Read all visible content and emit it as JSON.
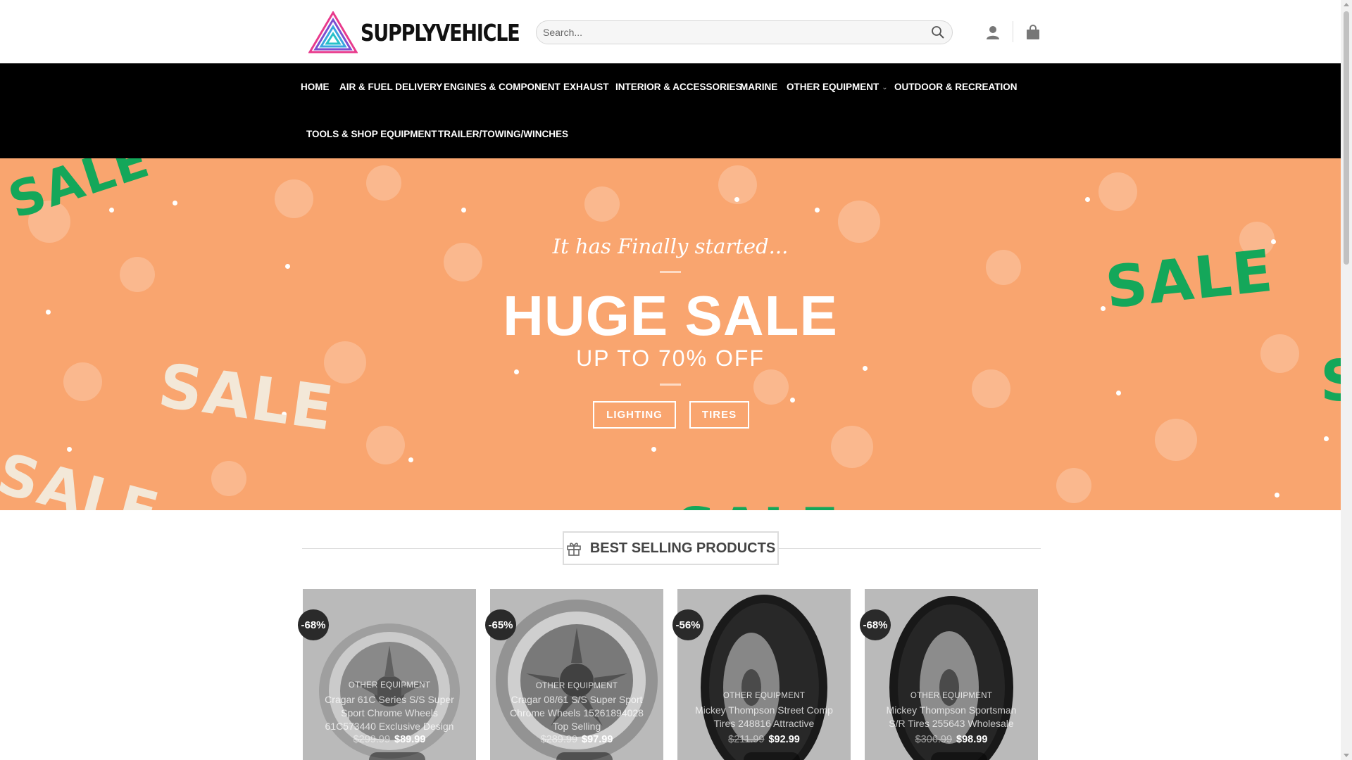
{
  "brand": {
    "name": "SUPPLYVEHICLE"
  },
  "search": {
    "placeholder": "Search..."
  },
  "nav": {
    "items": [
      "HOME",
      "AIR & FUEL DELIVERY",
      "ENGINES & COMPONENT",
      "EXHAUST",
      "INTERIOR & ACCESSORIES",
      "MARINE",
      "OTHER EQUIPMENT",
      "OUTDOOR & RECREATION",
      "TOOLS & SHOP EQUIPMENT",
      "TRAILER/TOWING/WINCHES"
    ]
  },
  "hero": {
    "subtitle": "It has Finally started...",
    "title": "HUGE SALE",
    "offer": "UP TO 70% OFF",
    "buttons": [
      "LIGHTING",
      "TIRES"
    ],
    "decor_word": "SALE",
    "colors": {
      "background": "#f9a56f",
      "green": "#14a75a"
    }
  },
  "section": {
    "title": "BEST SELLING PRODUCTS"
  },
  "products": [
    {
      "badge": "-68%",
      "category": "OTHER EQUIPMENT",
      "name": "Cragar 61C Series S/S Super Sport Chrome Wheels 61C573440 Exclusive Design",
      "old_price": "$299.99",
      "price": "$89.99"
    },
    {
      "badge": "-65%",
      "category": "OTHER EQUIPMENT",
      "name": "Cragar 08/61 S/S Super Sport Chrome Wheels 15261894028 Top Selling",
      "old_price": "$289.99",
      "price": "$97.99"
    },
    {
      "badge": "-56%",
      "category": "OTHER EQUIPMENT",
      "name": "Mickey Thompson Street Comp Tires 248816 Attractive",
      "old_price": "$211.99",
      "price": "$92.99"
    },
    {
      "badge": "-68%",
      "category": "OTHER EQUIPMENT",
      "name": "Mickey Thompson Sportsman S/R Tires 255643 Wholesale",
      "old_price": "$306.99",
      "price": "$98.99"
    }
  ]
}
